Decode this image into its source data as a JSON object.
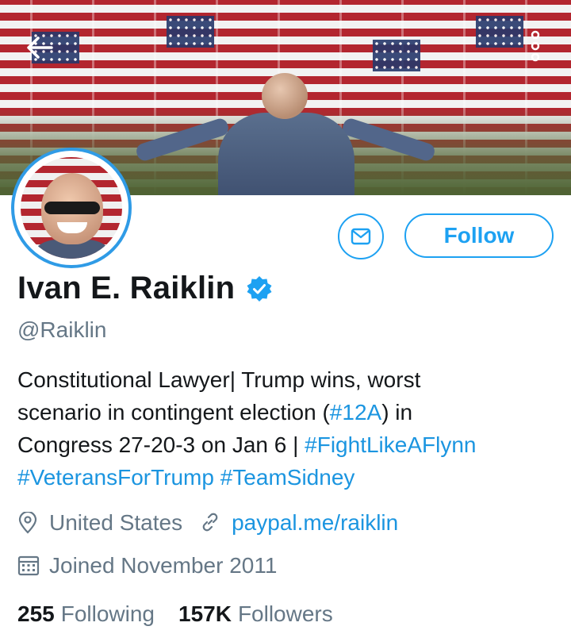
{
  "header": {
    "back_icon": "arrow-left-icon",
    "more_icon": "more-vertical-icon"
  },
  "profile": {
    "display_name": "Ivan E. Raiklin",
    "handle": "@Raiklin",
    "verified": true,
    "bio": {
      "t1": "Constitutional Lawyer| Trump wins, worst",
      "t2": "scenario in contingent election (",
      "tag1": "#12A",
      "t3": ") in",
      "t4": "Congress 27-20-3 on Jan 6 | ",
      "tag2": "#FightLikeAFlynn",
      "tag3": "#VeteransForTrump",
      "tag4": "#TeamSidney"
    },
    "location": "United States",
    "website": "paypal.me/raiklin",
    "joined": "Joined November 2011"
  },
  "actions": {
    "follow_label": "Follow",
    "message_icon": "mail-icon"
  },
  "stats": {
    "following_count": "255",
    "following_label": "Following",
    "followers_count": "157K",
    "followers_label": "Followers"
  },
  "colors": {
    "accent": "#1da1f2",
    "link": "#1b95e0",
    "muted": "#657786",
    "text": "#14171a"
  }
}
